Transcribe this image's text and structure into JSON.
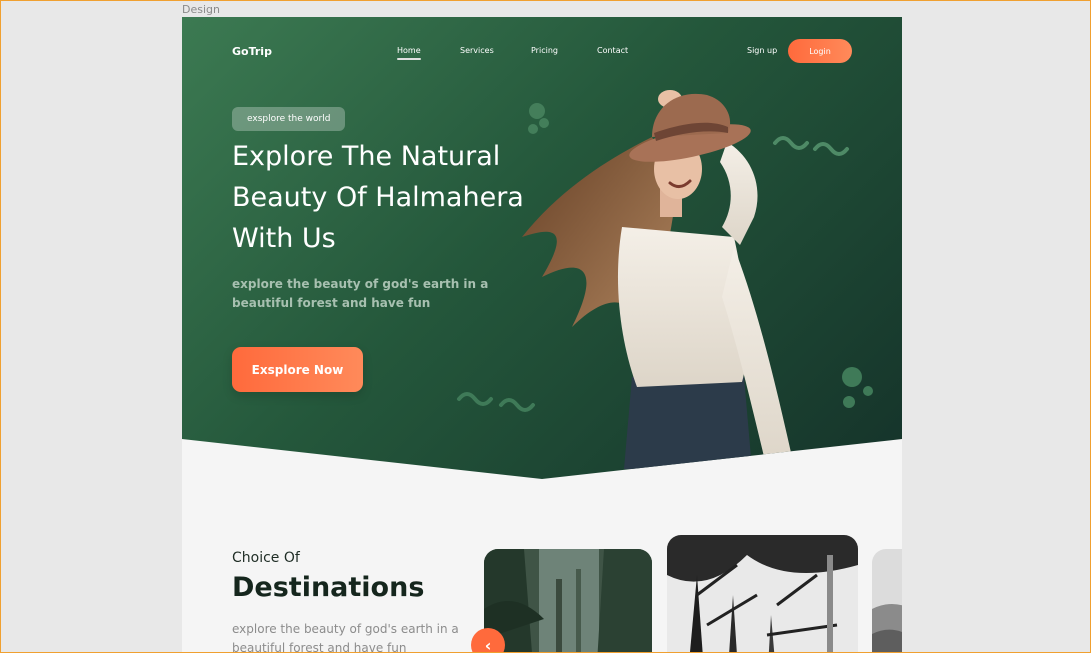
{
  "canvas": {
    "label": "Design"
  },
  "nav": {
    "logo": "GoTrip",
    "links": [
      "Home",
      "Services",
      "Pricing",
      "Contact"
    ],
    "active_link": "Home",
    "signup": "Sign up",
    "login": "Login"
  },
  "hero": {
    "pill": "exsplore the world",
    "title_lines": [
      "Explore The Natural",
      "Beauty Of Halmahera",
      "With Us"
    ],
    "subtitle": "explore the beauty of god's earth in a beautiful forest and have fun",
    "cta": "Exsplore Now"
  },
  "destinations": {
    "kicker": "Choice Of",
    "title": "Destinations",
    "subtitle": "explore the beauty of god's earth in a beautiful forest and have fun",
    "prev_icon": "chevron-left-icon"
  },
  "colors": {
    "hero_green": "#24573b",
    "accent_orange": "#ff6a3c",
    "background": "#f5f5f5"
  }
}
